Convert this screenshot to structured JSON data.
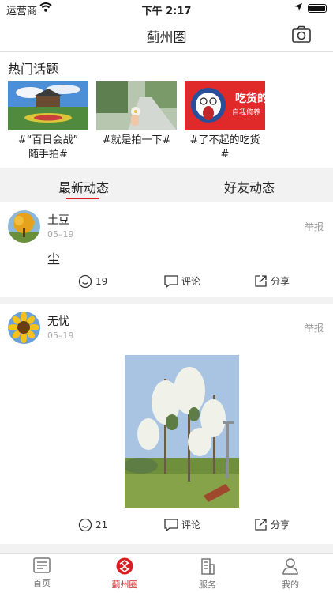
{
  "status": {
    "carrier": "运营商",
    "time": "下午 2:17"
  },
  "nav": {
    "title": "蓟州圈",
    "camera_icon": "camera-icon"
  },
  "topics": {
    "heading": "热门话题",
    "items": [
      {
        "caption_line1": "#“百日会战”",
        "caption_line2": "随手拍#"
      },
      {
        "caption_line1": "#就是拍一下#",
        "caption_line2": ""
      },
      {
        "caption_line1": "#了不起的吃货 #",
        "caption_line2": ""
      }
    ],
    "poster_text_1": "吃货的",
    "poster_text_2": "自我修养"
  },
  "tabs": {
    "latest": "最新动态",
    "friends": "好友动态"
  },
  "posts": [
    {
      "name": "土豆",
      "date": "05–19",
      "report": "举报",
      "text": "尘",
      "likes": "19",
      "comment": "评论",
      "share": "分享"
    },
    {
      "name": "无忧",
      "date": "05–19",
      "report": "举报",
      "text": "",
      "likes": "21",
      "comment": "评论",
      "share": "分享"
    }
  ],
  "tabbar": {
    "home": "首页",
    "circle": "蓟州圈",
    "service": "服务",
    "mine": "我的"
  },
  "colors": {
    "accent": "#d81e22"
  }
}
